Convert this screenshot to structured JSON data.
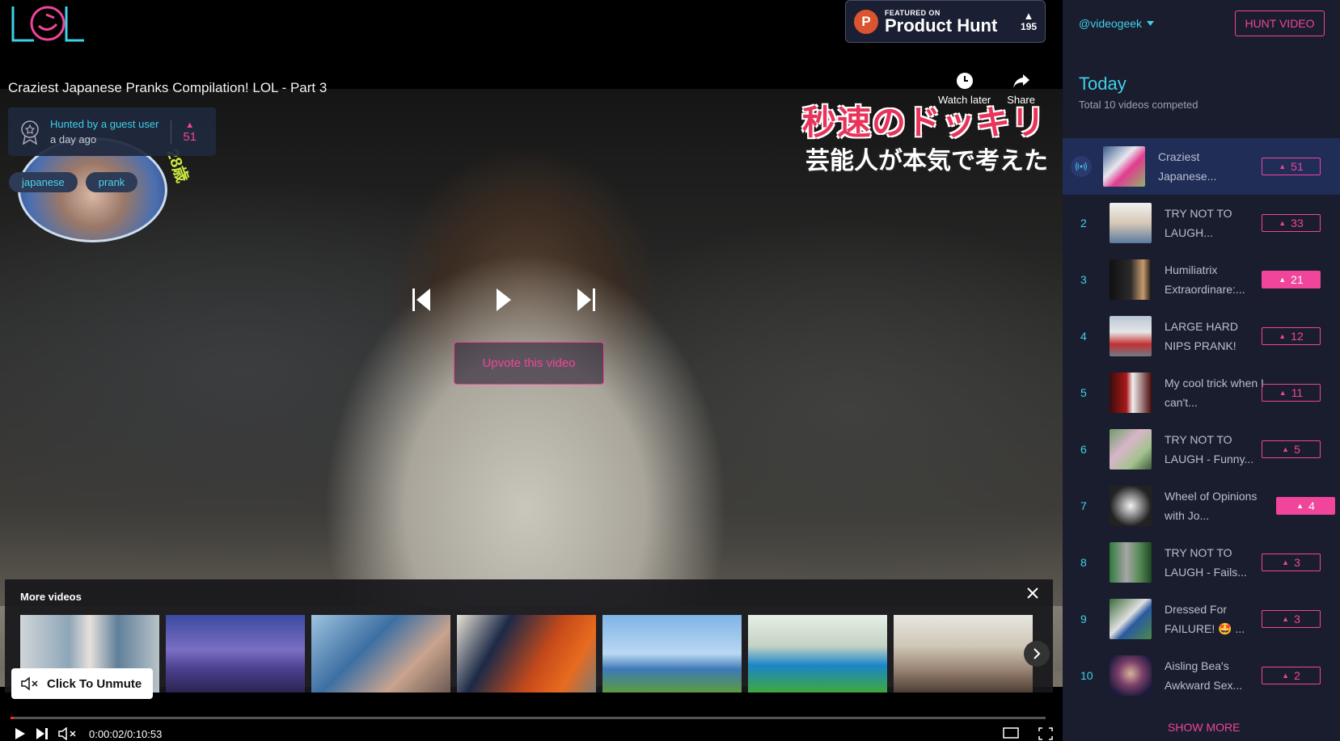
{
  "header": {
    "logo_text": "LOL",
    "product_hunt": {
      "featured_label": "FEATURED ON",
      "name": "Product Hunt",
      "votes": "195"
    }
  },
  "video": {
    "title": "Craziest Japanese Pranks Compilation! LOL - Part 3",
    "hunted_by": "Hunted by a guest user",
    "posted_time": "a day ago",
    "votes": "51",
    "tags": [
      "japanese",
      "prank"
    ],
    "watch_later_label": "Watch later",
    "share_label": "Share",
    "upvote_label": "Upvote this video",
    "overlay_text_1": "秒速のドッキリ",
    "overlay_text_2": "芸能人が本気で考えた",
    "overlay_number": "28歳"
  },
  "more_videos": {
    "title": "More videos"
  },
  "player": {
    "unmute_label": "Click To Unmute",
    "time_display": "0:00:02/0:10:53",
    "progress": 0.003
  },
  "sidebar": {
    "username": "@videogeek",
    "hunt_button": "HUNT VIDEO",
    "section_title": "Today",
    "total_text": "Total 10 videos competed",
    "show_more": "SHOW MORE",
    "items": [
      {
        "rank": "",
        "title": "Craziest Japanese...",
        "votes": "51",
        "active": true,
        "filled": false
      },
      {
        "rank": "2",
        "title": "TRY NOT TO LAUGH...",
        "votes": "33",
        "active": false,
        "filled": false
      },
      {
        "rank": "3",
        "title": "Humiliatrix Extraordinare:...",
        "votes": "21",
        "active": false,
        "filled": true
      },
      {
        "rank": "4",
        "title": "LARGE HARD NIPS PRANK!",
        "votes": "12",
        "active": false,
        "filled": false
      },
      {
        "rank": "5",
        "title": "My cool trick when I can't...",
        "votes": "11",
        "active": false,
        "filled": false
      },
      {
        "rank": "6",
        "title": "TRY NOT TO LAUGH - Funny...",
        "votes": "5",
        "active": false,
        "filled": false
      },
      {
        "rank": "7",
        "title": "Wheel of Opinions with Jo...",
        "votes": "4",
        "active": false,
        "filled": true
      },
      {
        "rank": "8",
        "title": "TRY NOT TO LAUGH - Fails...",
        "votes": "3",
        "active": false,
        "filled": false
      },
      {
        "rank": "9",
        "title": "Dressed For FAILURE! 🤩 ...",
        "votes": "3",
        "active": false,
        "filled": false
      },
      {
        "rank": "10",
        "title": "Aisling Bea's Awkward Sex...",
        "votes": "2",
        "active": false,
        "filled": false
      }
    ]
  },
  "colors": {
    "accent_pink": "#f0459a",
    "accent_cyan": "#3fd0e8",
    "sidebar_bg": "#1a1d2e"
  }
}
